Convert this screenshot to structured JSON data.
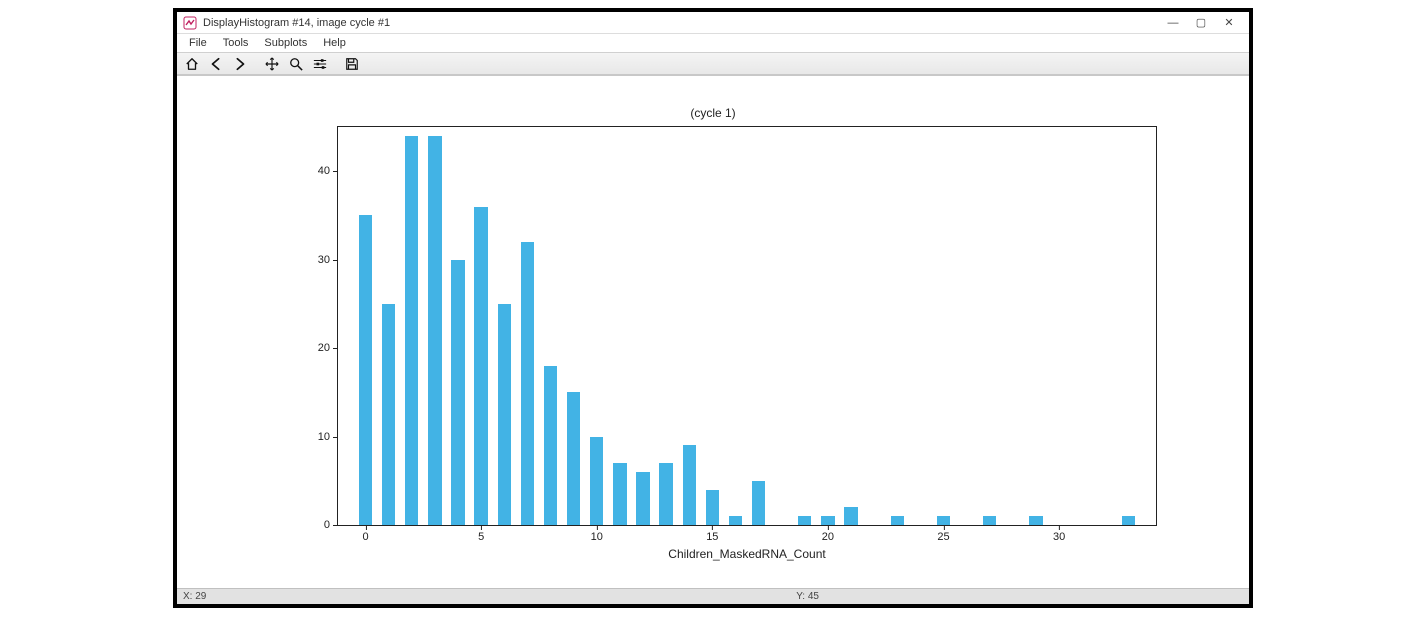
{
  "window": {
    "title": "DisplayHistogram #14, image cycle #1",
    "controls": {
      "minimize": "—",
      "maximize": "▢",
      "close": "✕"
    }
  },
  "menubar": [
    "File",
    "Tools",
    "Subplots",
    "Help"
  ],
  "toolbar": {
    "home": "home-icon",
    "back": "arrow-left-icon",
    "forward": "arrow-right-icon",
    "pan": "move-icon",
    "zoom": "zoom-icon",
    "configure": "sliders-icon",
    "save": "save-icon"
  },
  "statusbar": {
    "x_label": "X: 29",
    "y_label": "Y: 45"
  },
  "chart_data": {
    "type": "bar",
    "title": "(cycle 1)",
    "xlabel": "Children_MaskedRNA_Count",
    "ylabel": "",
    "ylim": [
      0,
      45
    ],
    "y_ticks": [
      0,
      10,
      20,
      30,
      40
    ],
    "x_ticks": [
      0,
      5,
      10,
      15,
      20,
      25,
      30
    ],
    "categories": [
      0,
      1,
      2,
      3,
      4,
      5,
      6,
      7,
      8,
      9,
      10,
      11,
      12,
      13,
      14,
      15,
      16,
      17,
      18,
      19,
      20,
      21,
      22,
      23,
      24,
      25,
      26,
      27,
      28,
      29,
      30,
      31,
      32,
      33
    ],
    "values": [
      35,
      25,
      44,
      44,
      30,
      36,
      25,
      32,
      18,
      15,
      10,
      7,
      6,
      7,
      9,
      4,
      1,
      5,
      0,
      1,
      1,
      2,
      0,
      1,
      0,
      1,
      0,
      1,
      0,
      1,
      0,
      0,
      0,
      1
    ],
    "bar_color": "#42b3e5"
  }
}
